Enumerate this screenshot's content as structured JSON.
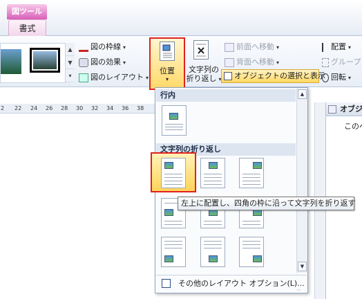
{
  "context_tab": "図ツール",
  "ribbon_tab": "書式",
  "picture_styles": {
    "border_label": "図の枠線",
    "effects_label": "図の効果",
    "layout_label": "図のレイアウト"
  },
  "arrange": {
    "position_label": "位置",
    "wrap_label_line1": "文字列の",
    "wrap_label_line2": "折り返し",
    "bring_forward": "前面へ移動",
    "send_backward": "背面へ移動",
    "selection_pane": "オブジェクトの選択と表示",
    "align": "配置",
    "group": "グループ",
    "rotate": "回転"
  },
  "ruler_ticks": [
    "2",
    "22",
    "24",
    "26",
    "28",
    "30",
    "32",
    "34",
    "36",
    "38"
  ],
  "dropdown": {
    "section_inline": "行内",
    "section_wrap": "文字列の折り返し",
    "footer": "その他のレイアウト オプション(L)..."
  },
  "tooltip": "左上に配置し、四角の枠に沿って文字列を折り返す",
  "task_pane": {
    "title": "オブジ",
    "body": "このペ"
  },
  "colors": {
    "accent_red": "#e02020",
    "highlight": "#ffd96a",
    "context_tab": "#d85fb8"
  }
}
